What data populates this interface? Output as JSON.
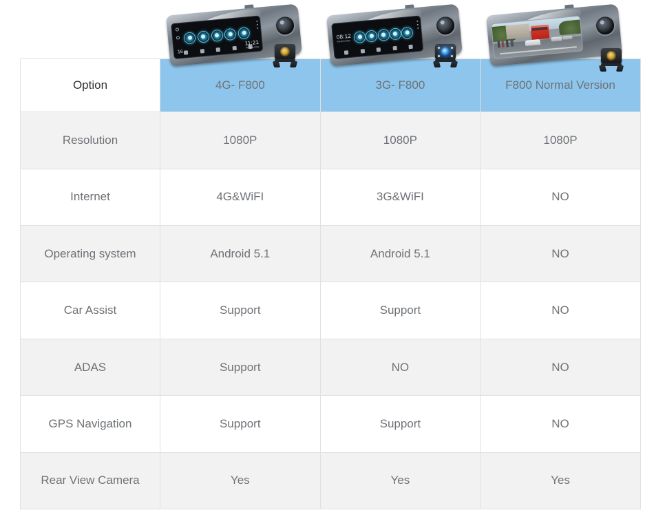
{
  "table": {
    "columns": [
      {
        "key": "option",
        "label": "Option"
      },
      {
        "key": "col4g",
        "label": "4G- F800"
      },
      {
        "key": "col3g",
        "label": "3G- F800"
      },
      {
        "key": "colnormal",
        "label": "F800 Normal Version"
      }
    ],
    "rows": [
      {
        "label": "Resolution",
        "values": [
          "1080P",
          "1080P",
          "1080P"
        ]
      },
      {
        "label": "Internet",
        "values": [
          "4G&WiFI",
          "3G&WiFI",
          "NO"
        ]
      },
      {
        "label": "Operating system",
        "values": [
          "Android 5.1",
          "Android 5.1",
          "NO"
        ]
      },
      {
        "label": "Car Assist",
        "values": [
          "Support",
          "Support",
          "NO"
        ]
      },
      {
        "label": "ADAS",
        "values": [
          "Support",
          "NO",
          "NO"
        ]
      },
      {
        "label": "GPS Navigation",
        "values": [
          "Support",
          "Support",
          "NO"
        ]
      },
      {
        "label": "Rear View Camera",
        "values": [
          "Yes",
          "Yes",
          "Yes"
        ]
      }
    ]
  },
  "products": [
    {
      "name": "4g-f800-device",
      "screen_type": "app-grid",
      "clock": "11:21",
      "clock_sub": "Wednesday",
      "left_indicator": "16",
      "camera_lens_color": "gold"
    },
    {
      "name": "3g-f800-device",
      "screen_type": "app-grid",
      "clock": "08:12",
      "clock_sub": "Wednesday",
      "left_indicator": "",
      "camera_lens_color": "blue"
    },
    {
      "name": "f800-normal-device",
      "screen_type": "mirror-view",
      "clock": "",
      "clock_sub": "",
      "left_indicator": "",
      "camera_lens_color": "gold"
    }
  ],
  "colors": {
    "header_blue": "#8dc5ec",
    "row_shaded": "#f2f2f2",
    "row_plain": "#ffffff",
    "border": "#e0e0e0",
    "label_text": "#2f3133",
    "data_text": "#6e7276",
    "header_text": "#ffffff"
  }
}
